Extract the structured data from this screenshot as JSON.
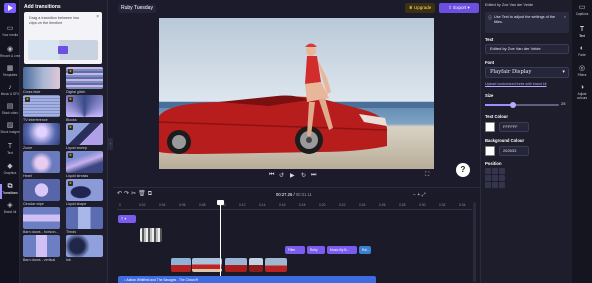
{
  "rail": {
    "items": [
      {
        "label": "Your media",
        "icon": "folder-icon"
      },
      {
        "label": "Record & create",
        "icon": "camera-icon"
      },
      {
        "label": "Templates",
        "icon": "template-icon"
      },
      {
        "label": "Music & SFX",
        "icon": "music-icon"
      },
      {
        "label": "Stock video",
        "icon": "film-icon"
      },
      {
        "label": "Stock images",
        "icon": "image-icon"
      },
      {
        "label": "Text",
        "icon": "text-icon"
      },
      {
        "label": "Graphics",
        "icon": "shapes-icon"
      },
      {
        "label": "Transitions",
        "icon": "transitions-icon"
      },
      {
        "label": "Brand kit",
        "icon": "brand-kit-icon"
      }
    ],
    "active": "Transitions"
  },
  "panel": {
    "title": "Add transitions",
    "tip": "Drag a transition between two clips on the timeline",
    "tiles": [
      {
        "name": "Cross fade",
        "premium": false
      },
      {
        "name": "Digital glitch",
        "premium": true
      },
      {
        "name": "TV interference",
        "premium": true
      },
      {
        "name": "Blocks",
        "premium": true
      },
      {
        "name": "Zoom",
        "premium": false
      },
      {
        "name": "Liquid sweep",
        "premium": true
      },
      {
        "name": "Heart",
        "premium": false
      },
      {
        "name": "Liquid streaks",
        "premium": true
      },
      {
        "name": "Circular wipe",
        "premium": false
      },
      {
        "name": "Liquid shape",
        "premium": true
      },
      {
        "name": "Barn doors - horizon...",
        "premium": false
      },
      {
        "name": "Thirds",
        "premium": false
      },
      {
        "name": "Barn doors - vertical",
        "premium": false
      },
      {
        "name": "Ink",
        "premium": false
      }
    ]
  },
  "topbar": {
    "project_name": "Ruby Tuesday",
    "upgrade_label": "Upgrade",
    "export_label": "Export"
  },
  "player": {
    "current_time": "00:27.26",
    "total_time": "00:31.11"
  },
  "props": {
    "header": "Edited by Zoe Van der Velde",
    "tip": "Use Text to adjust the settings of the titles.",
    "text_label": "Text",
    "text_value": "Edited by Zoe Van der Velde",
    "font_label": "Font",
    "font_value": "Playfair Display",
    "font_link": "Upload customized fonts with brand kit",
    "size_label": "Size",
    "size_value": 25,
    "size_percent": 0.38,
    "text_colour_label": "Text Colour",
    "text_colour_hex": "FFFFFF",
    "bg_colour_label": "Background Colour",
    "bg_colour_hex": "262633",
    "position_label": "Position"
  },
  "tools": [
    {
      "label": "Captions",
      "icon": "captions-icon"
    },
    {
      "label": "Text",
      "icon": "text-icon"
    },
    {
      "label": "Fade",
      "icon": "fade-icon"
    },
    {
      "label": "Filters",
      "icon": "filters-icon"
    },
    {
      "label": "Adjust colours",
      "icon": "adjust-colours-icon"
    }
  ],
  "timeline": {
    "ticks": [
      "0",
      "0:02",
      "0:04",
      "0:06",
      "0:08",
      "0:10",
      "0:12",
      "0:14",
      "0:16",
      "0:18",
      "0:20",
      "0:22",
      "0:24",
      "0:26",
      "0:28",
      "0:30",
      "0:32",
      "0:34"
    ],
    "title_clips": [
      "Filter",
      "Ruby",
      "Music By B...",
      "Edi..."
    ],
    "audio_label": "Adrian Whitfield and The Savages - The Clown/H"
  },
  "colors": {
    "accent": "#7b5cff",
    "export": "#6c4fe0",
    "upgrade": "#ffd978",
    "panel_bg": "#1d1d2c",
    "app_bg": "#1b1b2b"
  }
}
